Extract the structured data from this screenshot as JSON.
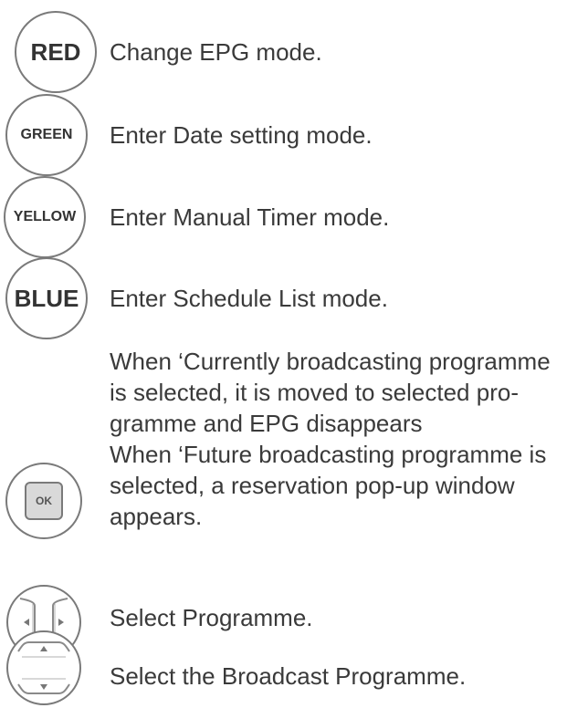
{
  "rows": [
    {
      "button": "RED",
      "text": "Change EPG mode."
    },
    {
      "button": "GREEN",
      "text": "Enter Date setting mode."
    },
    {
      "button": "YELLOW",
      "text": "Enter Manual Timer mode."
    },
    {
      "button": "BLUE",
      "text": "Enter Schedule List mode."
    }
  ],
  "ok": {
    "icon": "ok-button-icon",
    "lines": [
      "When ‘Currently broadcasting programme",
      "is selected, it is moved to selected pro-",
      "gramme and EPG disappears",
      "When ‘Future broadcasting programme is",
      "selected, a reservation pop-up window",
      "appears."
    ],
    "glyph": "OK"
  },
  "leftright": {
    "icon": "left-right-arrow-buttons-icon",
    "text": "Select Programme."
  },
  "updown": {
    "icon": "up-down-arrow-buttons-icon",
    "text": "Select the Broadcast Programme."
  }
}
